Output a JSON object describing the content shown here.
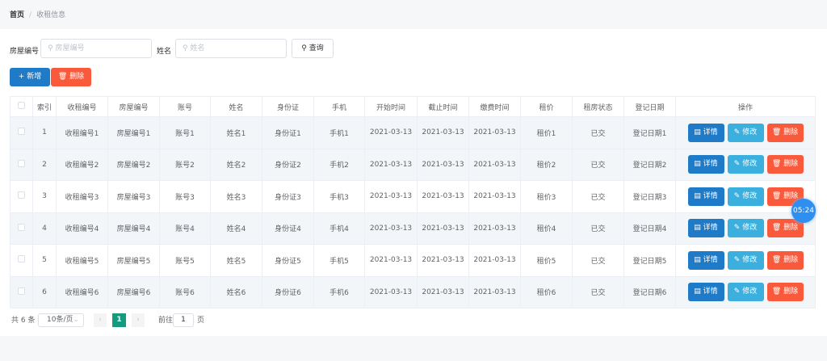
{
  "breadcrumb": {
    "home": "首页",
    "current": "收租信息"
  },
  "search": {
    "house_label": "房屋编号",
    "house_placeholder": "房屋编号",
    "name_label": "姓名",
    "name_placeholder": "姓名",
    "query": "查询"
  },
  "toolbar": {
    "add": "新增",
    "delete": "删除"
  },
  "colors": {
    "primary": "#1f7ac7",
    "info": "#3bb0de",
    "danger": "#fa5a3c",
    "page_active": "#149a7e"
  },
  "table": {
    "headers": [
      "索引",
      "收租编号",
      "房屋编号",
      "账号",
      "姓名",
      "身份证",
      "手机",
      "开始时间",
      "截止时间",
      "缴费时间",
      "租价",
      "租房状态",
      "登记日期",
      "操作"
    ],
    "rows": [
      [
        "1",
        "收租编号1",
        "房屋编号1",
        "账号1",
        "姓名1",
        "身份证1",
        "手机1",
        "2021-03-13",
        "2021-03-13",
        "2021-03-13",
        "租价1",
        "已交",
        "登记日期1"
      ],
      [
        "2",
        "收租编号2",
        "房屋编号2",
        "账号2",
        "姓名2",
        "身份证2",
        "手机2",
        "2021-03-13",
        "2021-03-13",
        "2021-03-13",
        "租价2",
        "已交",
        "登记日期2"
      ],
      [
        "3",
        "收租编号3",
        "房屋编号3",
        "账号3",
        "姓名3",
        "身份证3",
        "手机3",
        "2021-03-13",
        "2021-03-13",
        "2021-03-13",
        "租价3",
        "已交",
        "登记日期3"
      ],
      [
        "4",
        "收租编号4",
        "房屋编号4",
        "账号4",
        "姓名4",
        "身份证4",
        "手机4",
        "2021-03-13",
        "2021-03-13",
        "2021-03-13",
        "租价4",
        "已交",
        "登记日期4"
      ],
      [
        "5",
        "收租编号5",
        "房屋编号5",
        "账号5",
        "姓名5",
        "身份证5",
        "手机5",
        "2021-03-13",
        "2021-03-13",
        "2021-03-13",
        "租价5",
        "已交",
        "登记日期5"
      ],
      [
        "6",
        "收租编号6",
        "房屋编号6",
        "账号6",
        "姓名6",
        "身份证6",
        "手机6",
        "2021-03-13",
        "2021-03-13",
        "2021-03-13",
        "租价6",
        "已交",
        "登记日期6"
      ]
    ],
    "actions": {
      "detail": "详情",
      "edit": "修改",
      "delete": "删除"
    }
  },
  "pagination": {
    "total": "共 6 条",
    "page_size": "10条/页",
    "current_page": "1",
    "goto_label": "前往",
    "goto_value": "1",
    "goto_suffix": "页"
  },
  "timer": "05:24"
}
